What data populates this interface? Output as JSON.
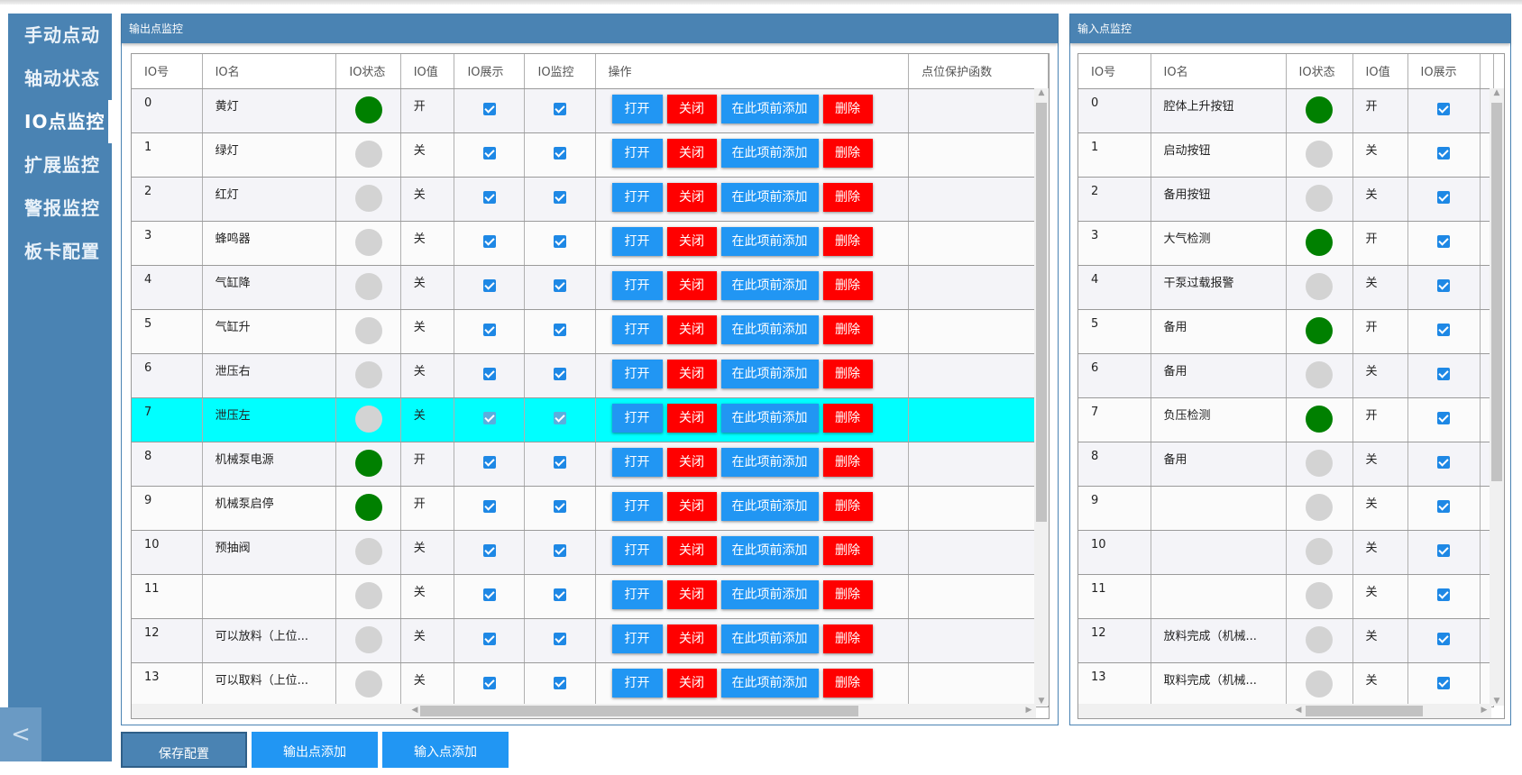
{
  "sidebar": {
    "items": [
      {
        "label": "手动点动",
        "active": false
      },
      {
        "label": "轴动状态",
        "active": false
      },
      {
        "label": "IO点监控",
        "active": true
      },
      {
        "label": "扩展监控",
        "active": false
      },
      {
        "label": "警报监控",
        "active": false
      },
      {
        "label": "板卡配置",
        "active": false
      }
    ],
    "collapse_glyph": "<"
  },
  "output_panel": {
    "title": "输出点监控",
    "columns": [
      "IO号",
      "IO名",
      "IO状态",
      "IO值",
      "IO展示",
      "IO监控",
      "操作",
      "点位保护函数"
    ],
    "actions": [
      "打开",
      "关闭",
      "在此项前添加",
      "删除"
    ],
    "selected_row": 7,
    "rows": [
      {
        "id": "0",
        "name": "黄灯",
        "on": true,
        "value": "开",
        "show": true,
        "monitor": true
      },
      {
        "id": "1",
        "name": "绿灯",
        "on": false,
        "value": "关",
        "show": true,
        "monitor": true
      },
      {
        "id": "2",
        "name": "红灯",
        "on": false,
        "value": "关",
        "show": true,
        "monitor": true
      },
      {
        "id": "3",
        "name": "蜂鸣器",
        "on": false,
        "value": "关",
        "show": true,
        "monitor": true
      },
      {
        "id": "4",
        "name": "气缸降",
        "on": false,
        "value": "关",
        "show": true,
        "monitor": true
      },
      {
        "id": "5",
        "name": "气缸升",
        "on": false,
        "value": "关",
        "show": true,
        "monitor": true
      },
      {
        "id": "6",
        "name": "泄压右",
        "on": false,
        "value": "关",
        "show": true,
        "monitor": true
      },
      {
        "id": "7",
        "name": "泄压左",
        "on": false,
        "value": "关",
        "show": true,
        "monitor": true
      },
      {
        "id": "8",
        "name": "机械泵电源",
        "on": true,
        "value": "开",
        "show": true,
        "monitor": true
      },
      {
        "id": "9",
        "name": "机械泵启停",
        "on": true,
        "value": "开",
        "show": true,
        "monitor": true
      },
      {
        "id": "10",
        "name": "预抽阀",
        "on": false,
        "value": "关",
        "show": true,
        "monitor": true
      },
      {
        "id": "11",
        "name": "",
        "on": false,
        "value": "关",
        "show": true,
        "monitor": true
      },
      {
        "id": "12",
        "name": "可以放料（上位...",
        "on": false,
        "value": "关",
        "show": true,
        "monitor": true
      },
      {
        "id": "13",
        "name": "可以取料（上位...",
        "on": false,
        "value": "关",
        "show": true,
        "monitor": true
      }
    ]
  },
  "input_panel": {
    "title": "输入点监控",
    "columns": [
      "IO号",
      "IO名",
      "IO状态",
      "IO值",
      "IO展示"
    ],
    "rows": [
      {
        "id": "0",
        "name": "腔体上升按钮",
        "on": true,
        "value": "开",
        "show": true
      },
      {
        "id": "1",
        "name": "启动按钮",
        "on": false,
        "value": "关",
        "show": true
      },
      {
        "id": "2",
        "name": "备用按钮",
        "on": false,
        "value": "关",
        "show": true
      },
      {
        "id": "3",
        "name": "大气检测",
        "on": true,
        "value": "开",
        "show": true
      },
      {
        "id": "4",
        "name": "干泵过载报警",
        "on": false,
        "value": "关",
        "show": true
      },
      {
        "id": "5",
        "name": "备用",
        "on": true,
        "value": "开",
        "show": true
      },
      {
        "id": "6",
        "name": "备用",
        "on": false,
        "value": "关",
        "show": true
      },
      {
        "id": "7",
        "name": "负压检测",
        "on": true,
        "value": "开",
        "show": true
      },
      {
        "id": "8",
        "name": "备用",
        "on": false,
        "value": "关",
        "show": true
      },
      {
        "id": "9",
        "name": "",
        "on": false,
        "value": "关",
        "show": true
      },
      {
        "id": "10",
        "name": "",
        "on": false,
        "value": "关",
        "show": true
      },
      {
        "id": "11",
        "name": "",
        "on": false,
        "value": "关",
        "show": true
      },
      {
        "id": "12",
        "name": "放料完成（机械...",
        "on": false,
        "value": "关",
        "show": true
      },
      {
        "id": "13",
        "name": "取料完成（机械...",
        "on": false,
        "value": "关",
        "show": true
      }
    ]
  },
  "bottom_buttons": {
    "save": "保存配置",
    "add_output": "输出点添加",
    "add_input": "输入点添加"
  },
  "colors": {
    "sidebar": "#4a83b3",
    "on": "#008000",
    "off": "#d3d3d3",
    "selected_row": "#00ffff",
    "action_blue": "#2196f3",
    "action_red": "#ff0000"
  }
}
